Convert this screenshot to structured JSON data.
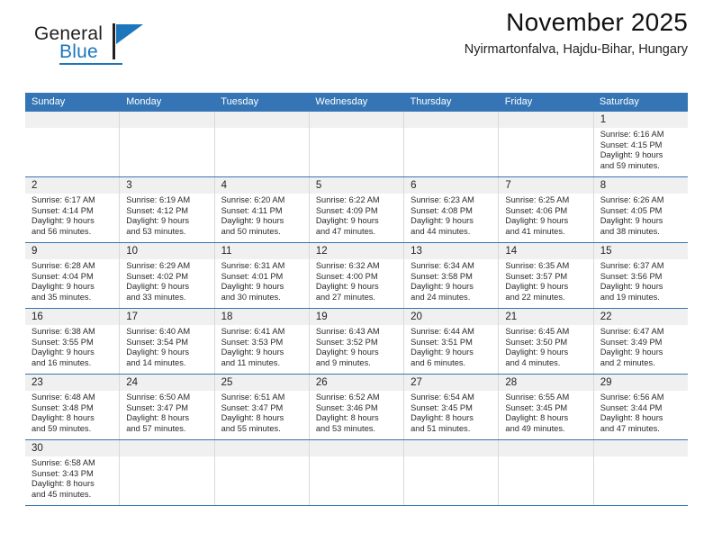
{
  "brand": {
    "name_part1": "General",
    "name_part2": "Blue",
    "accent_color": "#1c76bc"
  },
  "header": {
    "title": "November 2025",
    "subtitle": "Nyirmartonfalva, Hajdu-Bihar, Hungary"
  },
  "theme": {
    "header_bar_color": "#3575b5",
    "daynum_band_color": "#f0f0f0",
    "cell_border_color": "#d9d9d9",
    "text_color": "#2a2a2a"
  },
  "weekday_headers": [
    "Sunday",
    "Monday",
    "Tuesday",
    "Wednesday",
    "Thursday",
    "Friday",
    "Saturday"
  ],
  "labels": {
    "sunrise_prefix": "Sunrise:",
    "sunset_prefix": "Sunset:",
    "daylight_prefix": "Daylight:"
  },
  "weeks": [
    [
      {
        "day": "",
        "lines": [
          "",
          "",
          "",
          ""
        ]
      },
      {
        "day": "",
        "lines": [
          "",
          "",
          "",
          ""
        ]
      },
      {
        "day": "",
        "lines": [
          "",
          "",
          "",
          ""
        ]
      },
      {
        "day": "",
        "lines": [
          "",
          "",
          "",
          ""
        ]
      },
      {
        "day": "",
        "lines": [
          "",
          "",
          "",
          ""
        ]
      },
      {
        "day": "",
        "lines": [
          "",
          "",
          "",
          ""
        ]
      },
      {
        "day": "1",
        "lines": [
          "Sunrise: 6:16 AM",
          "Sunset: 4:15 PM",
          "Daylight: 9 hours",
          "and 59 minutes."
        ]
      }
    ],
    [
      {
        "day": "2",
        "lines": [
          "Sunrise: 6:17 AM",
          "Sunset: 4:14 PM",
          "Daylight: 9 hours",
          "and 56 minutes."
        ]
      },
      {
        "day": "3",
        "lines": [
          "Sunrise: 6:19 AM",
          "Sunset: 4:12 PM",
          "Daylight: 9 hours",
          "and 53 minutes."
        ]
      },
      {
        "day": "4",
        "lines": [
          "Sunrise: 6:20 AM",
          "Sunset: 4:11 PM",
          "Daylight: 9 hours",
          "and 50 minutes."
        ]
      },
      {
        "day": "5",
        "lines": [
          "Sunrise: 6:22 AM",
          "Sunset: 4:09 PM",
          "Daylight: 9 hours",
          "and 47 minutes."
        ]
      },
      {
        "day": "6",
        "lines": [
          "Sunrise: 6:23 AM",
          "Sunset: 4:08 PM",
          "Daylight: 9 hours",
          "and 44 minutes."
        ]
      },
      {
        "day": "7",
        "lines": [
          "Sunrise: 6:25 AM",
          "Sunset: 4:06 PM",
          "Daylight: 9 hours",
          "and 41 minutes."
        ]
      },
      {
        "day": "8",
        "lines": [
          "Sunrise: 6:26 AM",
          "Sunset: 4:05 PM",
          "Daylight: 9 hours",
          "and 38 minutes."
        ]
      }
    ],
    [
      {
        "day": "9",
        "lines": [
          "Sunrise: 6:28 AM",
          "Sunset: 4:04 PM",
          "Daylight: 9 hours",
          "and 35 minutes."
        ]
      },
      {
        "day": "10",
        "lines": [
          "Sunrise: 6:29 AM",
          "Sunset: 4:02 PM",
          "Daylight: 9 hours",
          "and 33 minutes."
        ]
      },
      {
        "day": "11",
        "lines": [
          "Sunrise: 6:31 AM",
          "Sunset: 4:01 PM",
          "Daylight: 9 hours",
          "and 30 minutes."
        ]
      },
      {
        "day": "12",
        "lines": [
          "Sunrise: 6:32 AM",
          "Sunset: 4:00 PM",
          "Daylight: 9 hours",
          "and 27 minutes."
        ]
      },
      {
        "day": "13",
        "lines": [
          "Sunrise: 6:34 AM",
          "Sunset: 3:58 PM",
          "Daylight: 9 hours",
          "and 24 minutes."
        ]
      },
      {
        "day": "14",
        "lines": [
          "Sunrise: 6:35 AM",
          "Sunset: 3:57 PM",
          "Daylight: 9 hours",
          "and 22 minutes."
        ]
      },
      {
        "day": "15",
        "lines": [
          "Sunrise: 6:37 AM",
          "Sunset: 3:56 PM",
          "Daylight: 9 hours",
          "and 19 minutes."
        ]
      }
    ],
    [
      {
        "day": "16",
        "lines": [
          "Sunrise: 6:38 AM",
          "Sunset: 3:55 PM",
          "Daylight: 9 hours",
          "and 16 minutes."
        ]
      },
      {
        "day": "17",
        "lines": [
          "Sunrise: 6:40 AM",
          "Sunset: 3:54 PM",
          "Daylight: 9 hours",
          "and 14 minutes."
        ]
      },
      {
        "day": "18",
        "lines": [
          "Sunrise: 6:41 AM",
          "Sunset: 3:53 PM",
          "Daylight: 9 hours",
          "and 11 minutes."
        ]
      },
      {
        "day": "19",
        "lines": [
          "Sunrise: 6:43 AM",
          "Sunset: 3:52 PM",
          "Daylight: 9 hours",
          "and 9 minutes."
        ]
      },
      {
        "day": "20",
        "lines": [
          "Sunrise: 6:44 AM",
          "Sunset: 3:51 PM",
          "Daylight: 9 hours",
          "and 6 minutes."
        ]
      },
      {
        "day": "21",
        "lines": [
          "Sunrise: 6:45 AM",
          "Sunset: 3:50 PM",
          "Daylight: 9 hours",
          "and 4 minutes."
        ]
      },
      {
        "day": "22",
        "lines": [
          "Sunrise: 6:47 AM",
          "Sunset: 3:49 PM",
          "Daylight: 9 hours",
          "and 2 minutes."
        ]
      }
    ],
    [
      {
        "day": "23",
        "lines": [
          "Sunrise: 6:48 AM",
          "Sunset: 3:48 PM",
          "Daylight: 8 hours",
          "and 59 minutes."
        ]
      },
      {
        "day": "24",
        "lines": [
          "Sunrise: 6:50 AM",
          "Sunset: 3:47 PM",
          "Daylight: 8 hours",
          "and 57 minutes."
        ]
      },
      {
        "day": "25",
        "lines": [
          "Sunrise: 6:51 AM",
          "Sunset: 3:47 PM",
          "Daylight: 8 hours",
          "and 55 minutes."
        ]
      },
      {
        "day": "26",
        "lines": [
          "Sunrise: 6:52 AM",
          "Sunset: 3:46 PM",
          "Daylight: 8 hours",
          "and 53 minutes."
        ]
      },
      {
        "day": "27",
        "lines": [
          "Sunrise: 6:54 AM",
          "Sunset: 3:45 PM",
          "Daylight: 8 hours",
          "and 51 minutes."
        ]
      },
      {
        "day": "28",
        "lines": [
          "Sunrise: 6:55 AM",
          "Sunset: 3:45 PM",
          "Daylight: 8 hours",
          "and 49 minutes."
        ]
      },
      {
        "day": "29",
        "lines": [
          "Sunrise: 6:56 AM",
          "Sunset: 3:44 PM",
          "Daylight: 8 hours",
          "and 47 minutes."
        ]
      }
    ],
    [
      {
        "day": "30",
        "lines": [
          "Sunrise: 6:58 AM",
          "Sunset: 3:43 PM",
          "Daylight: 8 hours",
          "and 45 minutes."
        ]
      },
      {
        "day": "",
        "lines": [
          "",
          "",
          "",
          ""
        ]
      },
      {
        "day": "",
        "lines": [
          "",
          "",
          "",
          ""
        ]
      },
      {
        "day": "",
        "lines": [
          "",
          "",
          "",
          ""
        ]
      },
      {
        "day": "",
        "lines": [
          "",
          "",
          "",
          ""
        ]
      },
      {
        "day": "",
        "lines": [
          "",
          "",
          "",
          ""
        ]
      },
      {
        "day": "",
        "lines": [
          "",
          "",
          "",
          ""
        ]
      }
    ]
  ]
}
